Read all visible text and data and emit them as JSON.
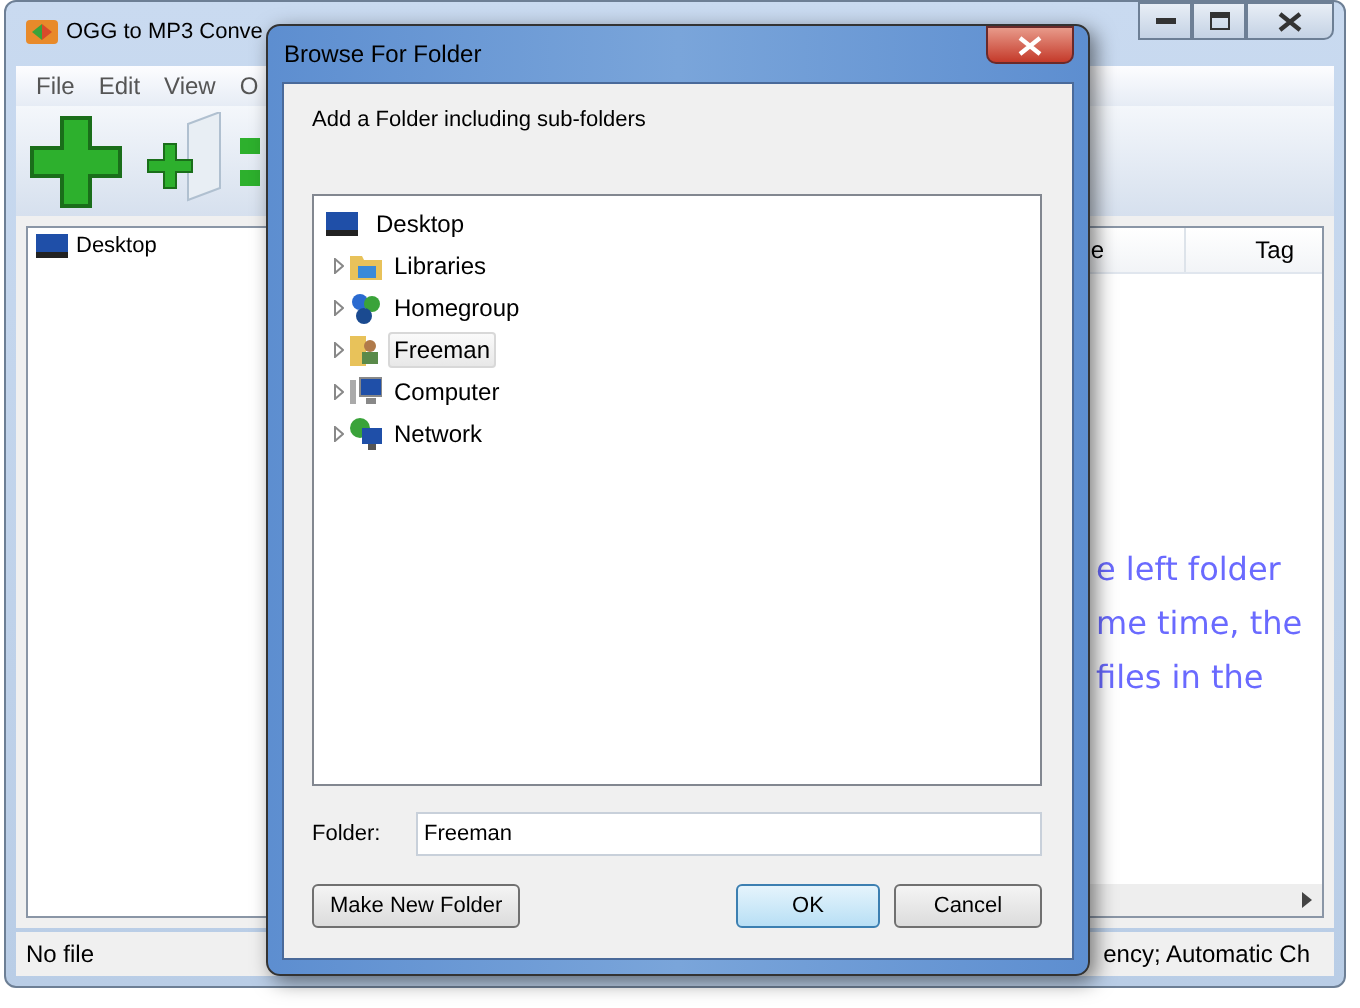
{
  "main_window": {
    "title": "OGG to MP3 Conve",
    "menu": [
      "File",
      "Edit",
      "View",
      "O"
    ],
    "folder_tree": [
      {
        "label": "Desktop"
      }
    ],
    "file_list": {
      "columns": [
        "e",
        "Tag"
      ],
      "message_lines": [
        "e left folder",
        "me time, the",
        "files in the"
      ]
    },
    "status_bar": [
      "No file",
      "ency; Automatic Ch"
    ]
  },
  "dialog": {
    "title": "Browse For Folder",
    "instruction": "Add a Folder including sub-folders",
    "tree": {
      "label": "Desktop",
      "children": [
        {
          "label": "Libraries",
          "kind": "libraries",
          "selected": false
        },
        {
          "label": "Homegroup",
          "kind": "homegroup",
          "selected": false
        },
        {
          "label": "Freeman",
          "kind": "user",
          "selected": true
        },
        {
          "label": "Computer",
          "kind": "computer",
          "selected": false
        },
        {
          "label": "Network",
          "kind": "network",
          "selected": false
        }
      ]
    },
    "folder_label": "Folder:",
    "folder_value": "Freeman",
    "buttons": [
      {
        "label": "Make New Folder",
        "kind": "secondary"
      },
      {
        "label": "OK",
        "kind": "default"
      },
      {
        "label": "Cancel",
        "kind": "secondary"
      }
    ]
  }
}
